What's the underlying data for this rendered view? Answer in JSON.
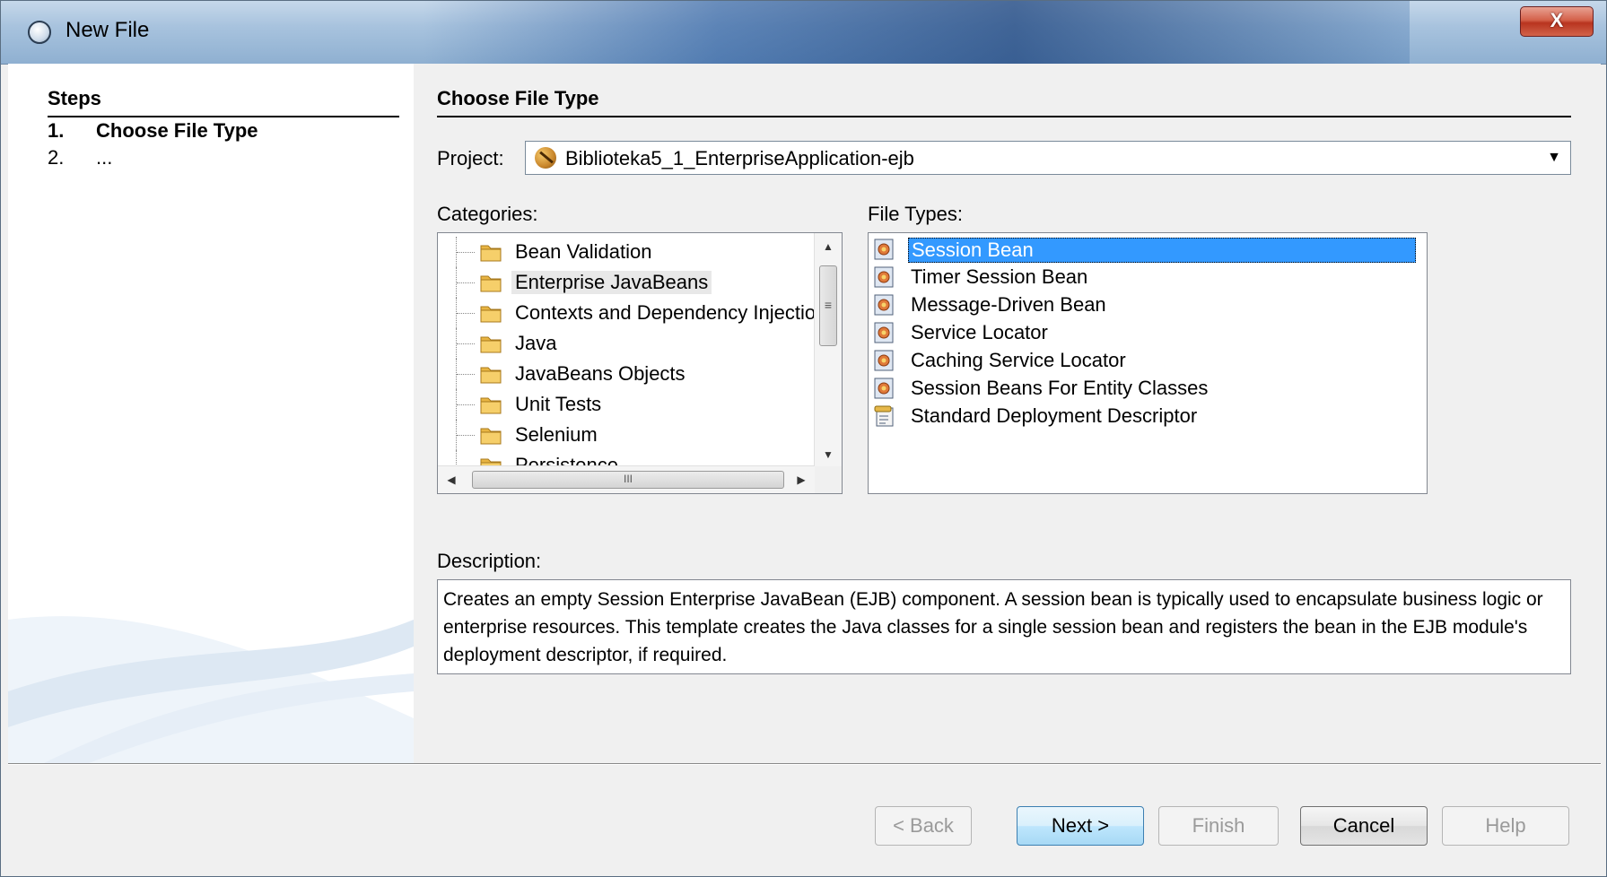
{
  "window": {
    "title": "New File",
    "close_label": "X"
  },
  "steps": {
    "heading": "Steps",
    "items": [
      {
        "num": "1.",
        "label": "Choose File Type"
      },
      {
        "num": "2.",
        "label": "..."
      }
    ]
  },
  "main": {
    "heading": "Choose File Type",
    "project_label": "Project:",
    "project_value": "Biblioteka5_1_EnterpriseApplication-ejb",
    "categories_label": "Categories:",
    "categories": [
      "Bean Validation",
      "Enterprise JavaBeans",
      "Contexts and Dependency Injection",
      "Java",
      "JavaBeans Objects",
      "Unit Tests",
      "Selenium",
      "Persistence"
    ],
    "selected_category": "Enterprise JavaBeans",
    "file_types_label": "File Types:",
    "file_types": [
      "Session Bean",
      "Timer Session Bean",
      "Message-Driven Bean",
      "Service Locator",
      "Caching Service Locator",
      "Session Beans For Entity Classes",
      "Standard Deployment Descriptor"
    ],
    "selected_file_type": "Session Bean",
    "description_label": "Description:",
    "description": "Creates an empty Session Enterprise JavaBean (EJB) component. A session bean is typically used to encapsulate business logic or enterprise resources. This template creates the Java classes for a single session bean and registers the bean in the EJB module's deployment descriptor, if required."
  },
  "buttons": {
    "back": "< Back",
    "next": "Next >",
    "finish": "Finish",
    "cancel": "Cancel",
    "help": "Help"
  },
  "icons": {
    "window": "netbeans-cube-icon",
    "project": "ejb-project-icon",
    "category": "folder-icon",
    "file_type": "bean-file-icon",
    "descriptor": "descriptor-file-icon"
  },
  "colors": {
    "selection": "#3399ff",
    "panel_bg": "#f0f0f0",
    "steps_bg": "#ffffff",
    "titlebar": "#a8c3de"
  }
}
